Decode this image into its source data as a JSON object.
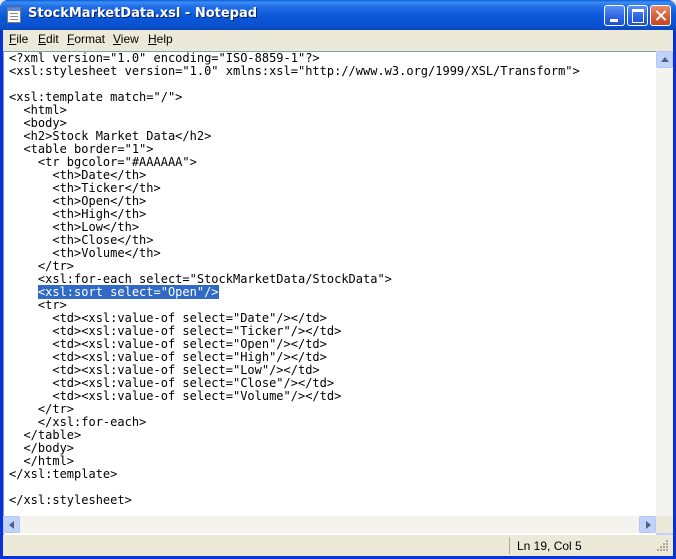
{
  "window": {
    "title": "StockMarketData.xsl - Notepad"
  },
  "menu": [
    "File",
    "Edit",
    "Format",
    "View",
    "Help"
  ],
  "editor": {
    "lines": [
      "<?xml version=\"1.0\" encoding=\"ISO-8859-1\"?>",
      "<xsl:stylesheet version=\"1.0\" xmlns:xsl=\"http://www.w3.org/1999/XSL/Transform\">",
      "",
      "<xsl:template match=\"/\">",
      "  <html>",
      "  <body>",
      "  <h2>Stock Market Data</h2>",
      "  <table border=\"1\">",
      "    <tr bgcolor=\"#AAAAAA\">",
      "      <th>Date</th>",
      "      <th>Ticker</th>",
      "      <th>Open</th>",
      "      <th>High</th>",
      "      <th>Low</th>",
      "      <th>Close</th>",
      "      <th>Volume</th>",
      "    </tr>",
      "    <xsl:for-each select=\"StockMarketData/StockData\">",
      "    <xsl:sort select=\"Open\"/>",
      "    <tr>",
      "      <td><xsl:value-of select=\"Date\"/></td>",
      "      <td><xsl:value-of select=\"Ticker\"/></td>",
      "      <td><xsl:value-of select=\"Open\"/></td>",
      "      <td><xsl:value-of select=\"High\"/></td>",
      "      <td><xsl:value-of select=\"Low\"/></td>",
      "      <td><xsl:value-of select=\"Close\"/></td>",
      "      <td><xsl:value-of select=\"Volume\"/></td>",
      "    </tr>",
      "    </xsl:for-each>",
      "  </table>",
      "  </body>",
      "  </html>",
      "</xsl:template>",
      "",
      "</xsl:stylesheet>"
    ],
    "selected_line_number": 19,
    "selection_color": "#316ac5"
  },
  "status": {
    "position": "Ln 19, Col 5"
  },
  "colors": {
    "titlebar": "#0b58d8",
    "close_button": "#d65a32"
  }
}
